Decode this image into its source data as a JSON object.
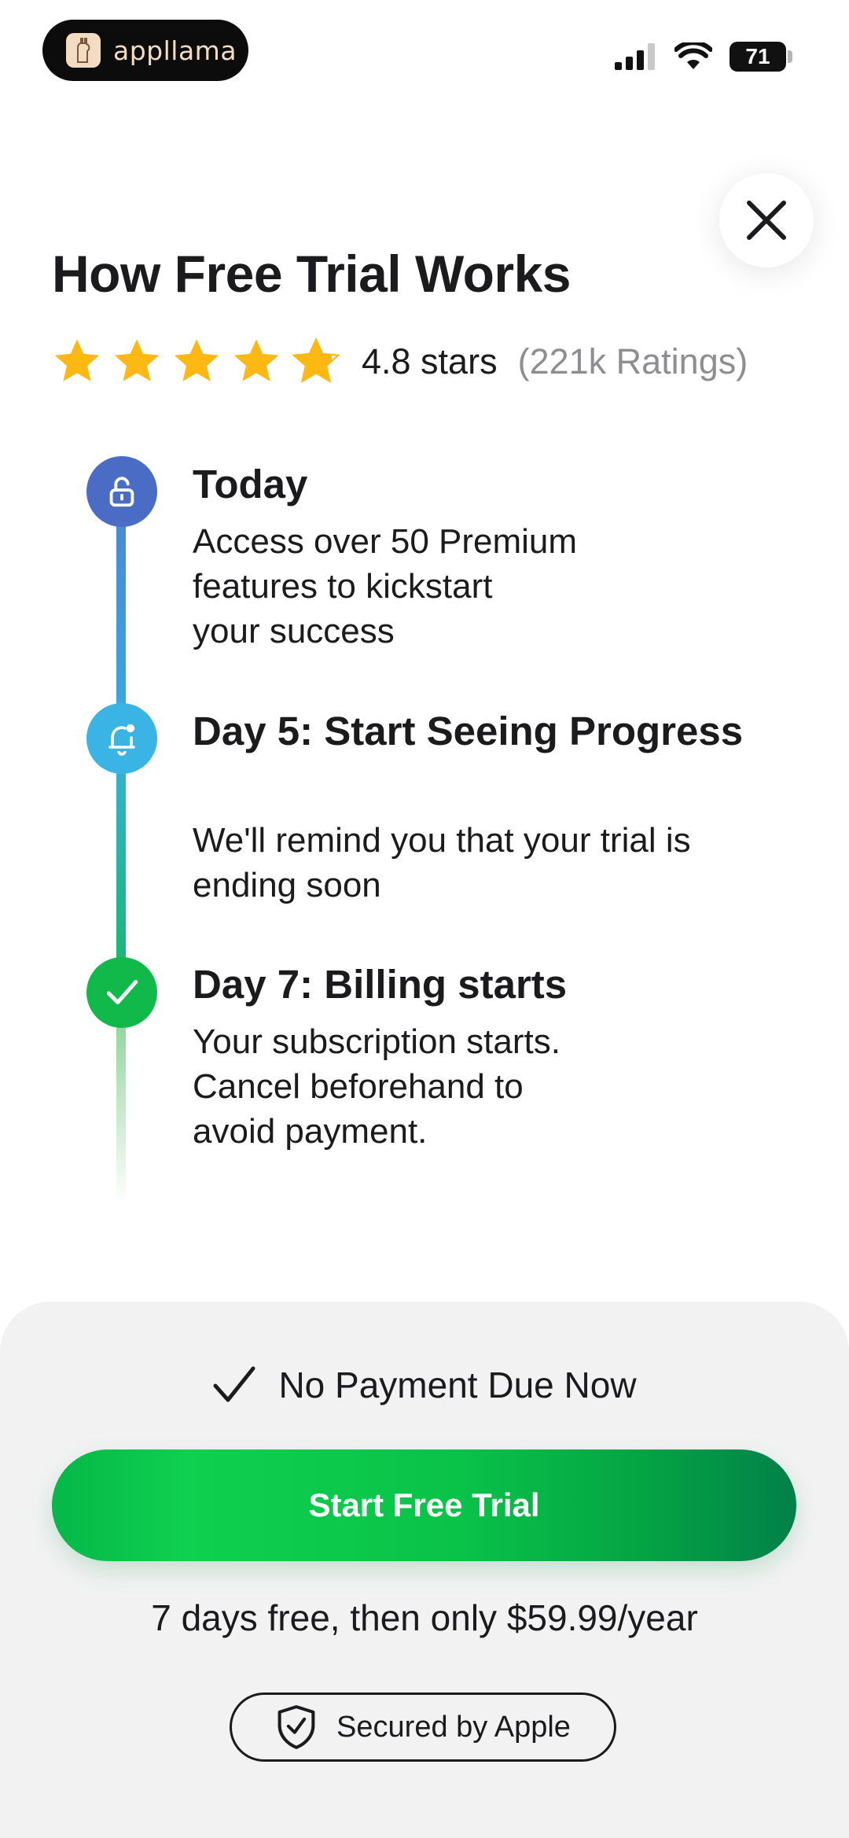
{
  "status_bar": {
    "app_name": "appllama",
    "battery_level": "71",
    "icons": [
      "signal-icon",
      "wifi-icon",
      "battery-icon"
    ]
  },
  "header": {
    "title": "How Free Trial Works",
    "close_icon": "close-icon"
  },
  "rating": {
    "stars": 4.8,
    "value_label": "4.8 stars",
    "count_label": "(221k Ratings)",
    "star_color": "#FDB813"
  },
  "timeline": {
    "steps": [
      {
        "icon": "unlock-icon",
        "color": "#4A6CC4",
        "title": "Today",
        "description": "Access over 50 Premium\nfeatures to kickstart\nyour success"
      },
      {
        "icon": "bell-icon",
        "color": "#3AB4E4",
        "title": "Day 5: Start Seeing Progress",
        "description": "We'll remind you that your trial is\nending soon"
      },
      {
        "icon": "check-icon",
        "color": "#10B94A",
        "title": "Day 7: Billing starts",
        "description": "Your subscription starts.\nCancel beforehand to\navoid payment."
      }
    ]
  },
  "footer": {
    "no_payment": "No Payment Due Now",
    "cta_label": "Start Free Trial",
    "price_text": "7 days free, then only $59.99/year",
    "secured_label": "Secured by Apple",
    "cta_color": "#09C248"
  }
}
